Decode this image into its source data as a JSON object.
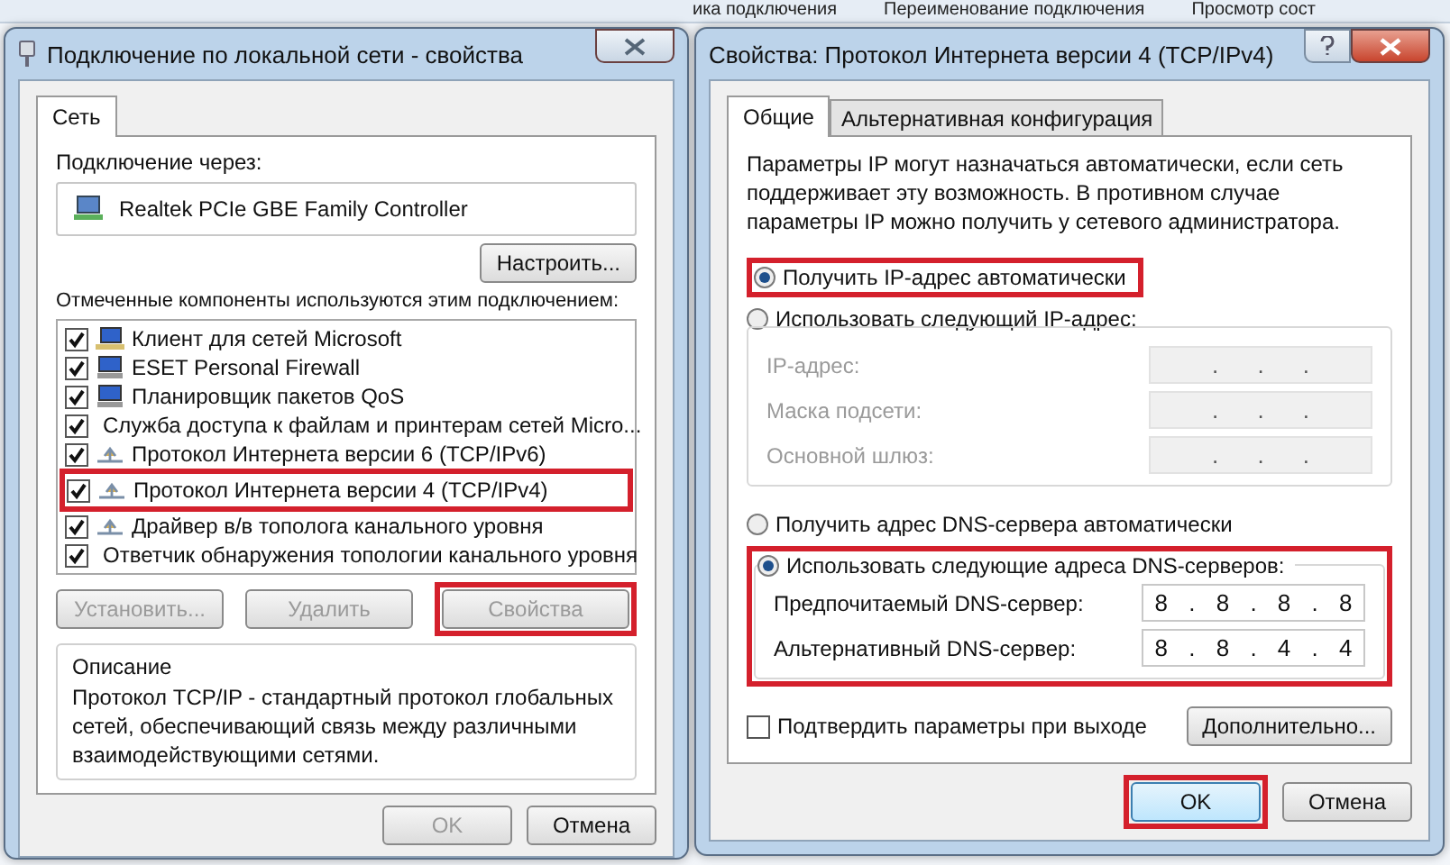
{
  "background": {
    "toolbar_items": [
      "ика подключения",
      "Переименование подключения",
      "Просмотр сост"
    ]
  },
  "left_window": {
    "title": "Подключение по локальной сети - свойства",
    "tabs": [
      {
        "label": "Сеть",
        "selected": true
      }
    ],
    "connect_via_label": "Подключение через:",
    "adapter": "Realtek PCIe GBE Family Controller",
    "configure_button": "Настроить...",
    "components_label": "Отмеченные компоненты используются этим подключением:",
    "components": [
      {
        "label": "Клиент для сетей Microsoft",
        "checked": true,
        "kind": "client"
      },
      {
        "label": "ESET Personal Firewall",
        "checked": true,
        "kind": "service"
      },
      {
        "label": "Планировщик пакетов QoS",
        "checked": true,
        "kind": "service"
      },
      {
        "label": "Служба доступа к файлам и принтерам сетей Micro...",
        "checked": true,
        "kind": "service"
      },
      {
        "label": "Протокол Интернета версии 6 (TCP/IPv6)",
        "checked": true,
        "kind": "protocol"
      },
      {
        "label": "Протокол Интернета версии 4 (TCP/IPv4)",
        "checked": true,
        "kind": "protocol",
        "highlighted": true
      },
      {
        "label": "Драйвер в/в тополога канального уровня",
        "checked": true,
        "kind": "protocol"
      },
      {
        "label": "Ответчик обнаружения топологии канального уровня",
        "checked": true,
        "kind": "protocol"
      }
    ],
    "buttons": [
      {
        "label": "Установить...",
        "disabled": true
      },
      {
        "label": "Удалить",
        "disabled": true
      },
      {
        "label": "Свойства",
        "disabled": true,
        "highlighted": true
      }
    ],
    "description": {
      "title": "Описание",
      "text": "Протокол TCP/IP - стандартный протокол глобальных сетей, обеспечивающий связь между различными взаимодействующими сетями."
    },
    "footer_buttons": [
      {
        "label": "OK",
        "disabled": true
      },
      {
        "label": "Отмена",
        "disabled": false
      }
    ]
  },
  "right_window": {
    "title": "Свойства: Протокол Интернета версии 4 (TCP/IPv4)",
    "tabs": [
      {
        "label": "Общие",
        "selected": true
      },
      {
        "label": "Альтернативная конфигурация",
        "selected": false
      }
    ],
    "intro": "Параметры IP могут назначаться автоматически, если сеть поддерживает эту возможность. В противном случае параметры IP можно получить у сетевого администратора.",
    "ip_modes": [
      {
        "label": "Получить IP-адрес автоматически",
        "selected": true,
        "highlighted": true
      },
      {
        "label": "Использовать следующий IP-адрес:",
        "selected": false
      }
    ],
    "ip_fields": [
      {
        "label": "IP-адрес:",
        "value": ". . .",
        "disabled": true
      },
      {
        "label": "Маска подсети:",
        "value": ". . .",
        "disabled": true
      },
      {
        "label": "Основной шлюз:",
        "value": ". . .",
        "disabled": true
      }
    ],
    "dns_modes": [
      {
        "label": "Получить адрес DNS-сервера автоматически",
        "selected": false
      },
      {
        "label": "Использовать следующие адреса DNS-серверов:",
        "selected": true
      }
    ],
    "dns_highlighted": true,
    "dns_fields": [
      {
        "label": "Предпочитаемый DNS-сервер:",
        "value": "8 . 8 . 8 . 8",
        "disabled": false
      },
      {
        "label": "Альтернативный DNS-сервер:",
        "value": "8 . 8 . 4 . 4",
        "disabled": false
      }
    ],
    "validate_checkbox": {
      "label": "Подтвердить параметры при выходе",
      "checked": false
    },
    "advanced_button": "Дополнительно...",
    "footer_buttons": [
      {
        "label": "OK",
        "disabled": false,
        "highlighted": true
      },
      {
        "label": "Отмена",
        "disabled": false
      }
    ]
  }
}
